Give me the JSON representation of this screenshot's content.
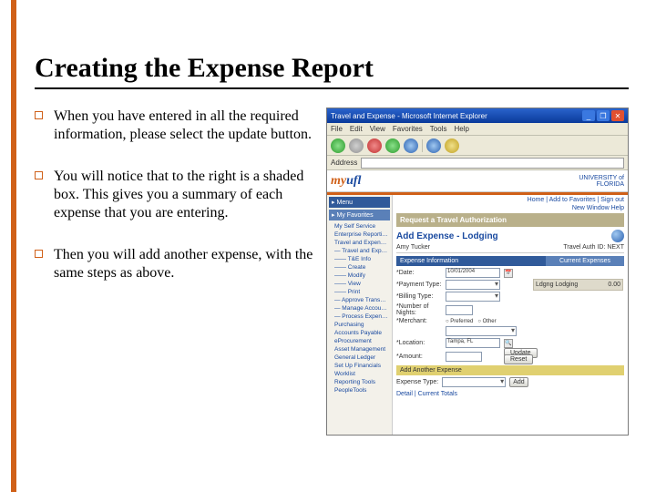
{
  "slide": {
    "title": "Creating the Expense Report",
    "bullets": [
      "When you have entered in all the required information, please select the update button.",
      "You will notice that to the right is a shaded box.  This gives you a summary of each expense that you are entering.",
      "Then you will add another expense, with the same steps as above."
    ]
  },
  "browser": {
    "title": "Travel and Expense - Microsoft Internet Explorer",
    "menu": [
      "File",
      "Edit",
      "View",
      "Favorites",
      "Tools",
      "Help"
    ],
    "logo_prefix": "my",
    "logo_suffix": "ufl",
    "right_label": "UNIVERSITY of\nFLORIDA",
    "toplinks": "Home | Add to Favorites | Sign out",
    "new_window": "New Window   Help"
  },
  "sidebar": {
    "hdr1": "Menu",
    "hdr2": "My Favorites",
    "items": [
      "My Self Service",
      "Enterprise Reporting",
      "Travel and Expenses",
      "— Travel and Expense",
      "—— T&E Info",
      "—— Create",
      "—— Modify",
      "—— View",
      "—— Print",
      "— Approve Transactions",
      "— Manage Accounting",
      "— Process Expenses",
      "Purchasing",
      "Accounts Payable",
      "eProcurement",
      "Asset Management",
      "General Ledger",
      "Set Up Financials",
      "Worklist",
      "Reporting Tools",
      "PeopleTools"
    ]
  },
  "page": {
    "breadcrumb": "Request a Travel Authorization",
    "heading": "Add Expense - Lodging",
    "traveler": "Amy Tucker",
    "auth_id": "Travel Auth ID:  NEXT",
    "sections": {
      "left": "Expense Information",
      "right": "Current Expenses"
    },
    "labels": {
      "date": "*Date:",
      "payment": "*Payment Type:",
      "billing": "*Billing Type:",
      "nights": "*Number of Nights:",
      "merchant": "*Merchant:",
      "location": "*Location:",
      "amount": "*Amount:",
      "summary_type": "Ldgng    Lodging",
      "summary_amt": "0.00"
    },
    "values": {
      "date": "10/01/2004",
      "location": "Tampa, FL"
    },
    "buttons": {
      "update": "Update",
      "reset": "Reset"
    },
    "add_section": "Add Another Expense",
    "expense_type_label": "Expense Type:",
    "link": "Detail | Current Totals"
  }
}
